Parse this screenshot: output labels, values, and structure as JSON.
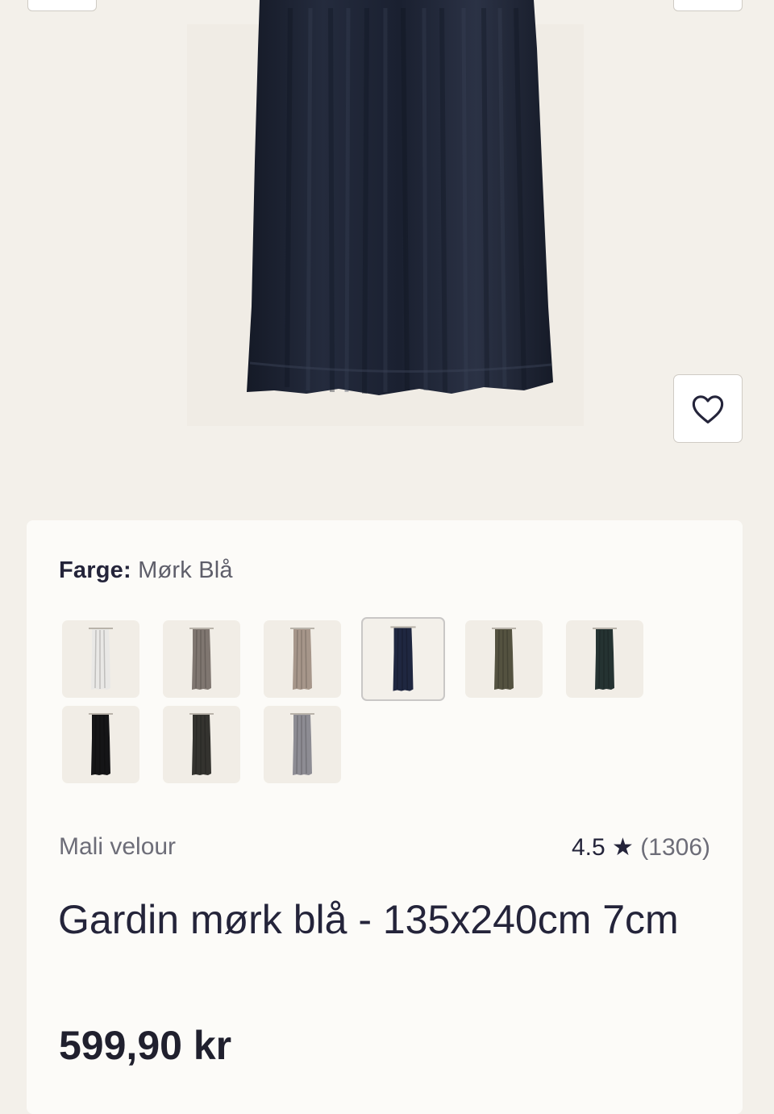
{
  "product_image": {
    "alt": "Gardin mørk blå",
    "curtain_color": "#1c2231"
  },
  "favorite": {
    "icon": "heart-icon"
  },
  "color_selector": {
    "label": "Farge:",
    "value": "Mørk Blå",
    "swatches": [
      {
        "name": "hvit",
        "color": "#e9e8e6",
        "selected": false
      },
      {
        "name": "grå-brun",
        "color": "#7f7670",
        "selected": false
      },
      {
        "name": "beige",
        "color": "#a6968a",
        "selected": false
      },
      {
        "name": "mørk blå",
        "color": "#1f2740",
        "selected": true
      },
      {
        "name": "olivengrønn",
        "color": "#545240",
        "selected": false
      },
      {
        "name": "mørk grønn",
        "color": "#253332",
        "selected": false
      },
      {
        "name": "svart",
        "color": "#151517",
        "selected": false
      },
      {
        "name": "antrasitt",
        "color": "#34332f",
        "selected": false
      },
      {
        "name": "lys grå",
        "color": "#8d8c93",
        "selected": false
      }
    ]
  },
  "product": {
    "brand": "Mali velour",
    "rating": "4.5",
    "rating_star": "★",
    "reviews": "(1306)",
    "title": "Gardin mørk blå - 135x240cm 7cm",
    "price": "599,90 kr"
  },
  "colors": {
    "page_bg": "#f3f0ea",
    "card_bg": "#fcfbf8",
    "text": "#24243a",
    "muted": "#6d6d78"
  }
}
